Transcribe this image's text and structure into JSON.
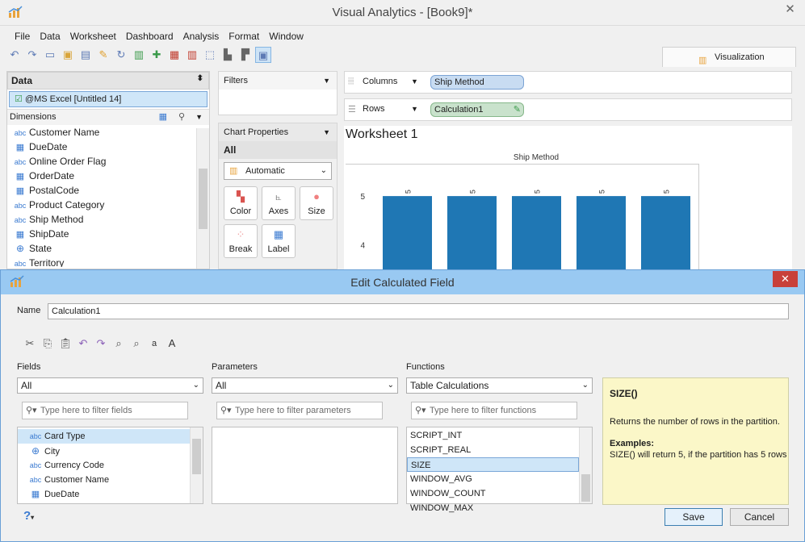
{
  "app": {
    "title": "Visual Analytics - [Book9]*",
    "close_glyph": "✕"
  },
  "menu": [
    "File",
    "Data",
    "Worksheet",
    "Dashboard",
    "Analysis",
    "Format",
    "Window"
  ],
  "toolbar_icons": [
    "undo-icon",
    "redo-icon",
    "new-worksheet-icon",
    "open-icon",
    "save-icon",
    "pen-icon",
    "refresh-icon",
    "add-chart-icon",
    "add-icon",
    "remove-icon",
    "remove-chart-icon",
    "select-icon",
    "sort-asc-icon",
    "sort-desc-icon",
    "fit-icon"
  ],
  "visualization_tab": "Visualization",
  "data_panel": {
    "header": "Data",
    "source": "@MS Excel [Untitled 14]",
    "dimensions_label": "Dimensions",
    "fields": [
      {
        "icon": "abc",
        "name": "Customer Name"
      },
      {
        "icon": "cal",
        "name": "DueDate"
      },
      {
        "icon": "abc",
        "name": "Online Order Flag"
      },
      {
        "icon": "cal",
        "name": "OrderDate"
      },
      {
        "icon": "cal",
        "name": "PostalCode"
      },
      {
        "icon": "abc",
        "name": "Product Category"
      },
      {
        "icon": "abc",
        "name": "Ship Method"
      },
      {
        "icon": "cal",
        "name": "ShipDate"
      },
      {
        "icon": "globe",
        "name": "State"
      },
      {
        "icon": "abc",
        "name": "Territory"
      }
    ]
  },
  "filters_label": "Filters",
  "chart_props": {
    "label": "Chart Properties",
    "all": "All",
    "mark_type": "Automatic",
    "buttons": [
      {
        "name": "color",
        "label": "Color"
      },
      {
        "name": "axes",
        "label": "Axes"
      },
      {
        "name": "size",
        "label": "Size"
      },
      {
        "name": "break",
        "label": "Break"
      },
      {
        "name": "label",
        "label": "Label"
      }
    ]
  },
  "shelves": {
    "columns_label": "Columns",
    "columns_pill": "Ship Method",
    "rows_label": "Rows",
    "rows_pill": "Calculation1"
  },
  "worksheet": {
    "title": "Worksheet 1"
  },
  "chart_data": {
    "type": "bar",
    "title": "Ship Method",
    "categories": [
      "",
      "",
      "",
      "",
      ""
    ],
    "values": [
      5,
      5,
      5,
      5,
      5
    ],
    "data_labels": [
      "5",
      "5",
      "5",
      "5",
      "5"
    ],
    "ytick_labels": [
      "5",
      "4"
    ],
    "yticks": [
      5,
      4
    ],
    "ylim": [
      3.5,
      5.2
    ]
  },
  "dialog": {
    "title": "Edit Calculated Field",
    "close_glyph": "✕",
    "name_label": "Name",
    "name_value": "Calculation1",
    "edit_icons": [
      "cut-icon",
      "copy-icon",
      "paste-icon",
      "undo-icon",
      "redo-icon",
      "find-icon",
      "replace-icon",
      "decrease-font-icon",
      "increase-font-icon"
    ],
    "font_small": "a",
    "font_large": "A",
    "fields": {
      "label": "Fields",
      "selected": "All",
      "placeholder": "Type here to filter fields",
      "items": [
        {
          "icon": "abc",
          "name": "Card Type"
        },
        {
          "icon": "globe",
          "name": "City"
        },
        {
          "icon": "abc",
          "name": "Currency Code"
        },
        {
          "icon": "abc",
          "name": "Customer Name"
        },
        {
          "icon": "cal",
          "name": "DueDate"
        }
      ]
    },
    "parameters": {
      "label": "Parameters",
      "selected": "All",
      "placeholder": "Type here to filter parameters"
    },
    "functions": {
      "label": "Functions",
      "selected": "Table Calculations",
      "placeholder": "Type here to filter functions",
      "items": [
        "SCRIPT_INT",
        "SCRIPT_REAL",
        "SIZE",
        "WINDOW_AVG",
        "WINDOW_COUNT",
        "WINDOW_MAX"
      ],
      "selected_item": "SIZE"
    },
    "help": {
      "title": "SIZE()",
      "description": "Returns the number of rows in the partition.",
      "examples_label": "Examples:",
      "example": "SIZE() will return 5, if the partition has 5 rows"
    },
    "help_glyph": "?",
    "save": "Save",
    "cancel": "Cancel"
  }
}
